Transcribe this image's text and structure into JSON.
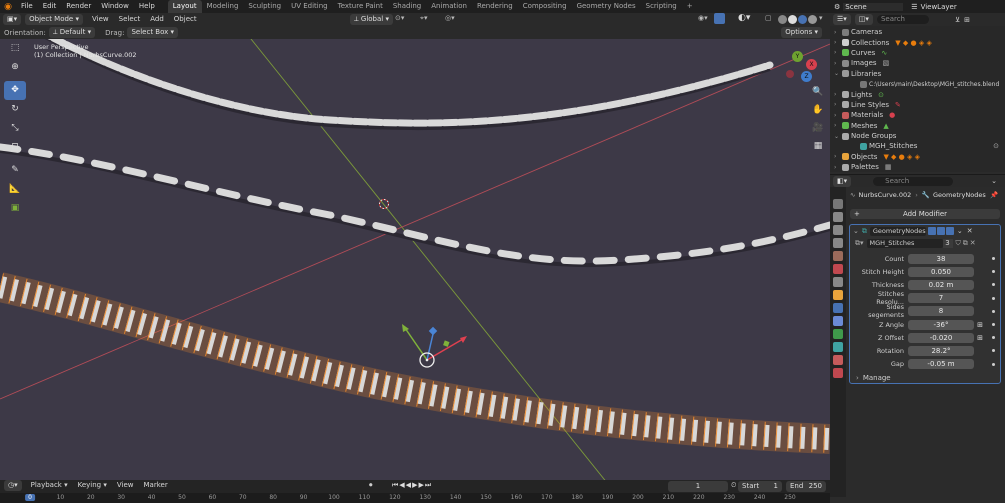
{
  "topbar": {
    "menus": [
      "File",
      "Edit",
      "Render",
      "Window",
      "Help"
    ],
    "workspaces": [
      "Layout",
      "Modeling",
      "Sculpting",
      "UV Editing",
      "Texture Paint",
      "Shading",
      "Animation",
      "Rendering",
      "Compositing",
      "Geometry Nodes",
      "Scripting"
    ],
    "active_workspace": "Layout",
    "add_tab": "+",
    "scene_label": "Scene",
    "view_layer_label": "ViewLayer"
  },
  "viewport_header": {
    "mode": "Object Mode",
    "menus": [
      "View",
      "Select",
      "Add",
      "Object"
    ],
    "transform_orientation": "Global"
  },
  "tool_header": {
    "orientation_label": "Orientation:",
    "orientation_value": "Default",
    "drag_label": "Drag:",
    "drag_value": "Select Box",
    "options": "Options"
  },
  "viewport": {
    "perspective_text": "User Perspective",
    "collection_text": "(1) Collection | NurbsCurve.002",
    "gizmo_axes": [
      "Y",
      "X",
      "Z"
    ]
  },
  "outliner": {
    "search_placeholder": "Search",
    "rows": [
      {
        "label": "Cameras"
      },
      {
        "label": "Collections"
      },
      {
        "label": "Curves"
      },
      {
        "label": "Images"
      },
      {
        "label": "Libraries"
      },
      {
        "label": "C:\\Users\\main\\Desktop\\MGH_stitches.blend",
        "indent": true
      },
      {
        "label": "Lights"
      },
      {
        "label": "Line Styles"
      },
      {
        "label": "Materials"
      },
      {
        "label": "Meshes"
      },
      {
        "label": "Node Groups"
      },
      {
        "label": "MGH_Stitches",
        "indent": true
      },
      {
        "label": "Objects"
      },
      {
        "label": "Palettes"
      }
    ]
  },
  "properties": {
    "search_placeholder": "Search",
    "breadcrumb_object": "NurbsCurve.002",
    "breadcrumb_modifier": "GeometryNodes",
    "add_modifier": "Add Modifier",
    "modifier_name": "GeometryNodes",
    "node_group": "MGH_Stitches",
    "node_group_users": "3",
    "inputs": [
      {
        "label": "Count",
        "value": "38"
      },
      {
        "label": "Stitch Height",
        "value": "0.050"
      },
      {
        "label": "Thickness",
        "value": "0.02 m"
      },
      {
        "label": "Stitches Resolu...",
        "value": "7"
      },
      {
        "label": "Sides segements",
        "value": "8"
      },
      {
        "label": "Z Angle",
        "value": "-36°"
      },
      {
        "label": "Z Offset",
        "value": "-0.020"
      },
      {
        "label": "Rotation",
        "value": "28.2°"
      },
      {
        "label": "Gap",
        "value": "-0.05 m"
      }
    ],
    "manage": "Manage"
  },
  "timeline": {
    "menus": [
      "Playback",
      "Keying",
      "View",
      "Marker"
    ],
    "current_frame": "1",
    "start_label": "Start",
    "start": "1",
    "end_label": "End",
    "end": "250",
    "ruler": [
      "0",
      "10",
      "20",
      "30",
      "40",
      "50",
      "60",
      "70",
      "80",
      "90",
      "100",
      "110",
      "120",
      "130",
      "140",
      "150",
      "160",
      "170",
      "180",
      "190",
      "200",
      "210",
      "220",
      "230",
      "240",
      "250"
    ]
  },
  "colors": {
    "viewport_bg": "#3d3947",
    "accent": "#4772b3",
    "selection": "#f28d2c",
    "stitch": "#d9d9d9"
  }
}
